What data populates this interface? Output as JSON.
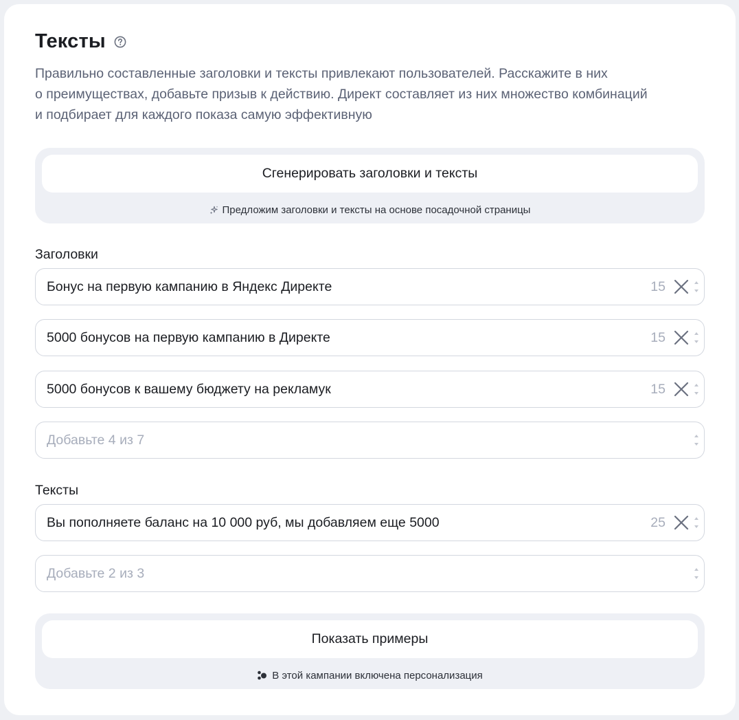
{
  "section": {
    "title": "Тексты",
    "help_icon": "question-circle-icon",
    "description_lines": [
      "Правильно составленные заголовки и тексты привлекают пользователей. Расскажите в них",
      "о преимуществах, добавьте призыв к действию. Директ составляет из них множество комбинаций",
      "и подбирает для каждого показа самую эффективную"
    ]
  },
  "generate": {
    "button_label": "Сгенерировать заголовки и тексты",
    "note": "Предложим заголовки и тексты на основе посадочной страницы",
    "note_icon": "sparkles-icon"
  },
  "headlines": {
    "label": "Заголовки",
    "items": [
      {
        "value": "Бонус на первую кампанию в Яндекс Директе",
        "counter": "15"
      },
      {
        "value": "5000 бонусов на первую кампанию в Директе",
        "counter": "15"
      },
      {
        "value": "5000 бонусов к вашему бюджету на рекламук",
        "counter": "15"
      }
    ],
    "add_placeholder": "Добавьте 4 из 7"
  },
  "texts": {
    "label": "Тексты",
    "items": [
      {
        "value": "Вы пополняете баланс на 10 000 руб, мы добавляем еще 5000",
        "counter": "25"
      }
    ],
    "add_placeholder": "Добавьте 2 из 3"
  },
  "examples": {
    "button_label": "Показать примеры",
    "note": "В этой кампании включена персонализация",
    "note_icon": "personalization-dots-icon"
  },
  "colors": {
    "page_bg": "#eef0f4",
    "panel_bg": "#eef0f5",
    "muted_text": "#5b6275",
    "placeholder": "#a7adbb",
    "border": "#d3d7df"
  }
}
